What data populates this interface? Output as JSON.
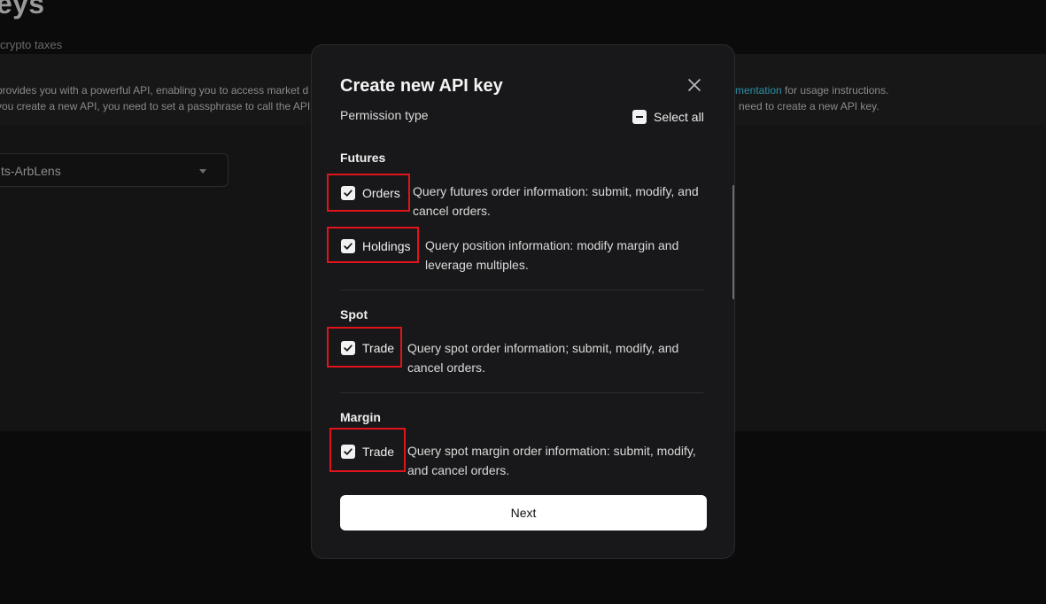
{
  "background": {
    "title": "eys",
    "subtitle": "crypto taxes",
    "info_line1_start": " provides you with a powerful API, enabling you to access market d",
    "info_line1_link": "mentation",
    "info_line1_end": " for usage instructions.",
    "info_line2_start": " you create a new API, you need to set a passphrase to call the API",
    "info_line2_end": "need to create a new API key.",
    "account_select": "ts-ArbLens"
  },
  "modal": {
    "title": "Create new API key",
    "permission_type_label": "Permission type",
    "select_all_label": "Select all",
    "next_label": "Next",
    "sections": {
      "futures": {
        "label": "Futures",
        "orders": {
          "label": "Orders",
          "checked": true,
          "desc": "Query futures order information: submit, modify, and cancel orders."
        },
        "holdings": {
          "label": "Holdings",
          "checked": true,
          "desc": "Query position information: modify margin and leverage multiples."
        }
      },
      "spot": {
        "label": "Spot",
        "trade": {
          "label": "Trade",
          "checked": true,
          "desc": "Query spot order information; submit, modify, and cancel orders."
        }
      },
      "margin": {
        "label": "Margin",
        "trade": {
          "label": "Trade",
          "checked": true,
          "desc": "Query spot margin order information: submit, modify, and cancel orders."
        }
      }
    }
  },
  "colors": {
    "highlight": "#e0141a",
    "link": "#2e8fa4",
    "modal_bg": "#18181a",
    "page_bg": "#0b0b0b"
  }
}
